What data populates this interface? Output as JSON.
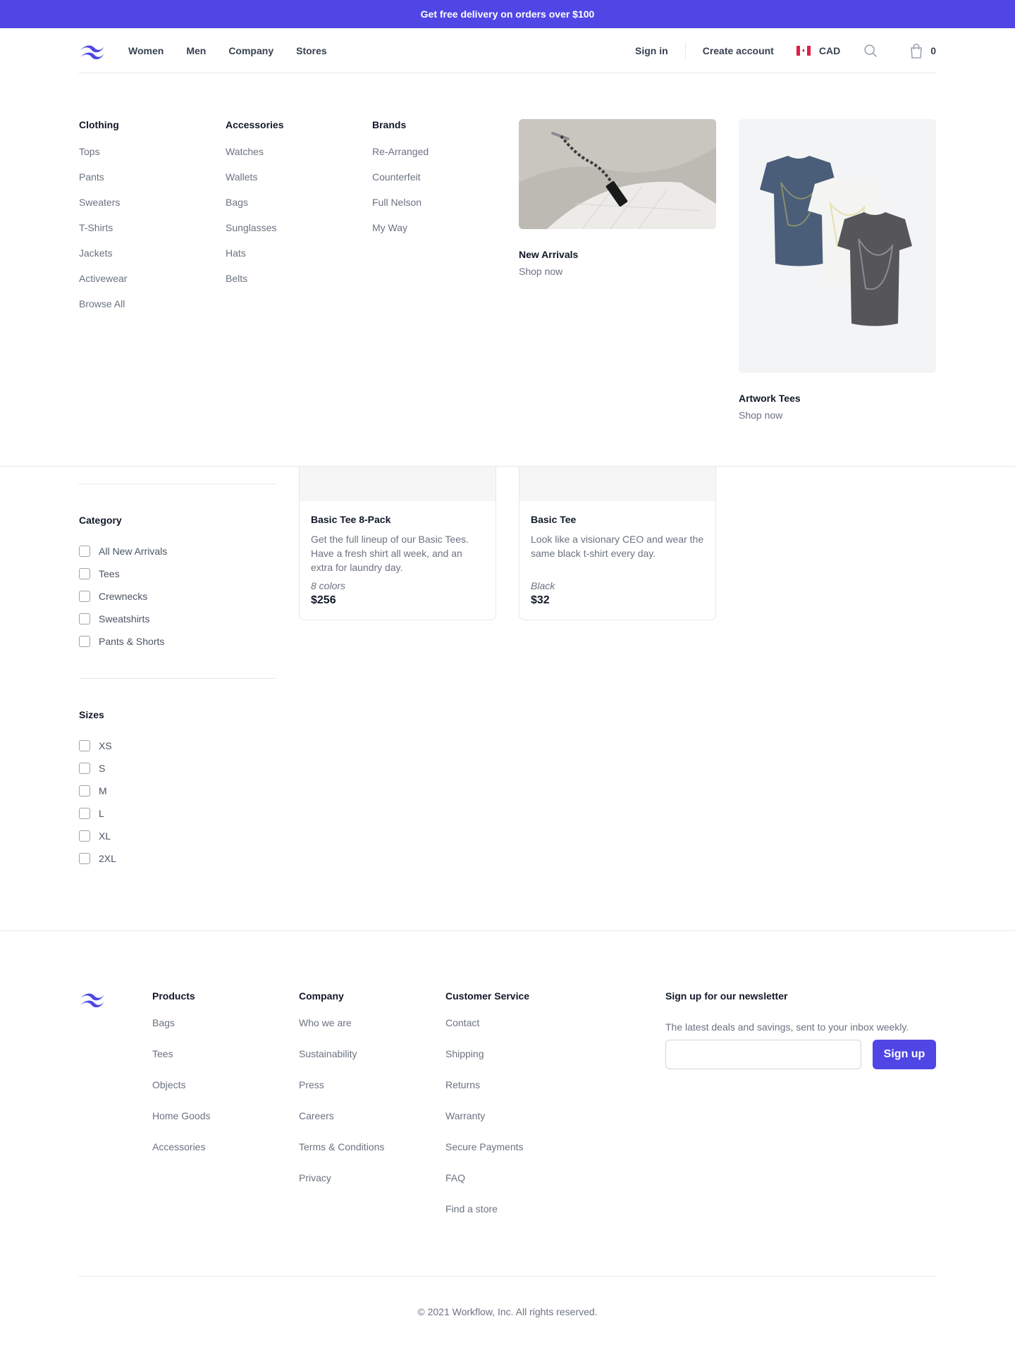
{
  "banner": {
    "text": "Get free delivery on orders over $100"
  },
  "header": {
    "nav": [
      "Women",
      "Men",
      "Company",
      "Stores"
    ],
    "sign_in": "Sign in",
    "create_account": "Create account",
    "currency": "CAD",
    "cart_count": "0",
    "icons": [
      "logo-icon",
      "canada-flag-icon",
      "search-icon",
      "shopping-bag-icon"
    ]
  },
  "flyout": {
    "columns": [
      {
        "heading": "Clothing",
        "items": [
          "Tops",
          "Pants",
          "Sweaters",
          "T-Shirts",
          "Jackets",
          "Activewear",
          "Browse All"
        ]
      },
      {
        "heading": "Accessories",
        "items": [
          "Watches",
          "Wallets",
          "Bags",
          "Sunglasses",
          "Hats",
          "Belts"
        ]
      },
      {
        "heading": "Brands",
        "items": [
          "Re-Arranged",
          "Counterfeit",
          "Full Nelson",
          "My Way"
        ]
      }
    ],
    "promos": [
      {
        "title": "New Arrivals",
        "cta": "Shop now"
      },
      {
        "title": "Artwork Tees",
        "cta": "Shop now"
      }
    ]
  },
  "filters": {
    "groups": [
      {
        "heading": "Category",
        "options": [
          "All New Arrivals",
          "Tees",
          "Crewnecks",
          "Sweatshirts",
          "Pants & Shorts"
        ]
      },
      {
        "heading": "Sizes",
        "options": [
          "XS",
          "S",
          "M",
          "L",
          "XL",
          "2XL"
        ]
      }
    ]
  },
  "products": [
    {
      "name": "Basic Tee 8-Pack",
      "description": "Get the full lineup of our Basic Tees. Have a fresh shirt all week, and an extra for laundry day.",
      "options": "8 colors",
      "price": "$256"
    },
    {
      "name": "Basic Tee",
      "description": "Look like a visionary CEO and wear the same black t-shirt every day.",
      "options": "Black",
      "price": "$32"
    }
  ],
  "footer": {
    "columns": [
      {
        "heading": "Products",
        "items": [
          "Bags",
          "Tees",
          "Objects",
          "Home Goods",
          "Accessories"
        ]
      },
      {
        "heading": "Company",
        "items": [
          "Who we are",
          "Sustainability",
          "Press",
          "Careers",
          "Terms & Conditions",
          "Privacy"
        ]
      },
      {
        "heading": "Customer Service",
        "items": [
          "Contact",
          "Shipping",
          "Returns",
          "Warranty",
          "Secure Payments",
          "FAQ",
          "Find a store"
        ]
      }
    ],
    "newsletter": {
      "heading": "Sign up for our newsletter",
      "text": "The latest deals and savings, sent to your inbox weekly.",
      "button": "Sign up"
    },
    "copyright": "© 2021 Workflow, Inc. All rights reserved."
  },
  "colors": {
    "accent": "#4F46E5",
    "border": "#E5E7EB",
    "muted_text": "#6B7280"
  }
}
